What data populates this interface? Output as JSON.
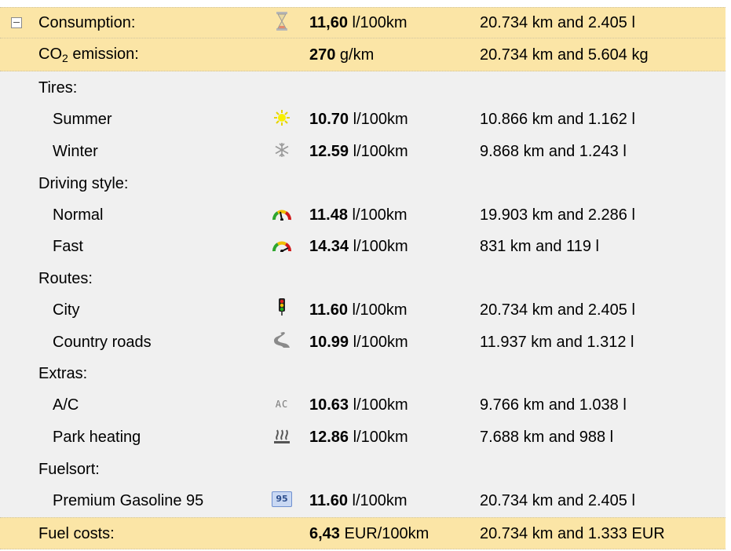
{
  "consumption": {
    "label": "Consumption:",
    "value": "11,60",
    "unit": " l/100km",
    "distance": "20.734 km and 2.405 l",
    "icon": "hourglass-icon"
  },
  "co2": {
    "label_prefix": "CO",
    "label_sub": "2",
    "label_suffix": " emission:",
    "value": "270",
    "unit": " g/km",
    "distance": "20.734 km and 5.604 kg"
  },
  "sections": {
    "tires": {
      "label": "Tires:",
      "summer": {
        "label": "Summer",
        "value": "10.70",
        "unit": " l/100km",
        "distance": "10.866 km and 1.162 l",
        "icon": "sun-icon"
      },
      "winter": {
        "label": "Winter",
        "value": "12.59",
        "unit": " l/100km",
        "distance": "9.868 km and 1.243 l",
        "icon": "snowflake-icon"
      }
    },
    "driving": {
      "label": "Driving style:",
      "normal": {
        "label": "Normal",
        "value": "11.48",
        "unit": " l/100km",
        "distance": "19.903 km and 2.286 l",
        "icon": "gauge-normal-icon"
      },
      "fast": {
        "label": "Fast",
        "value": "14.34",
        "unit": " l/100km",
        "distance": "831 km and 119 l",
        "icon": "gauge-fast-icon"
      }
    },
    "routes": {
      "label": "Routes:",
      "city": {
        "label": "City",
        "value": "11.60",
        "unit": " l/100km",
        "distance": "20.734 km and 2.405 l",
        "icon": "traffic-light-icon"
      },
      "country": {
        "label": "Country roads",
        "value": "10.99",
        "unit": " l/100km",
        "distance": "11.937 km and 1.312 l",
        "icon": "winding-road-icon"
      }
    },
    "extras": {
      "label": "Extras:",
      "ac": {
        "label": "A/C",
        "value": "10.63",
        "unit": " l/100km",
        "distance": "9.766 km and 1.038 l",
        "icon": "ac-icon",
        "icon_text": "AC"
      },
      "heating": {
        "label": "Park heating",
        "value": "12.86",
        "unit": " l/100km",
        "distance": "7.688 km and 988 l",
        "icon": "heating-icon"
      }
    },
    "fuelsort": {
      "label": "Fuelsort:",
      "premium": {
        "label": "Premium Gasoline 95",
        "value": "11.60",
        "unit": " l/100km",
        "distance": "20.734 km and 2.405 l",
        "icon": "fuel-95-icon",
        "icon_text": "95"
      }
    }
  },
  "costs": {
    "label": "Fuel costs:",
    "value": "6,43",
    "unit": " EUR/100km",
    "distance": "20.734 km and 1.333 EUR"
  },
  "colors": {
    "highlight": "#fbe5a6",
    "body": "#f0f0f0"
  }
}
